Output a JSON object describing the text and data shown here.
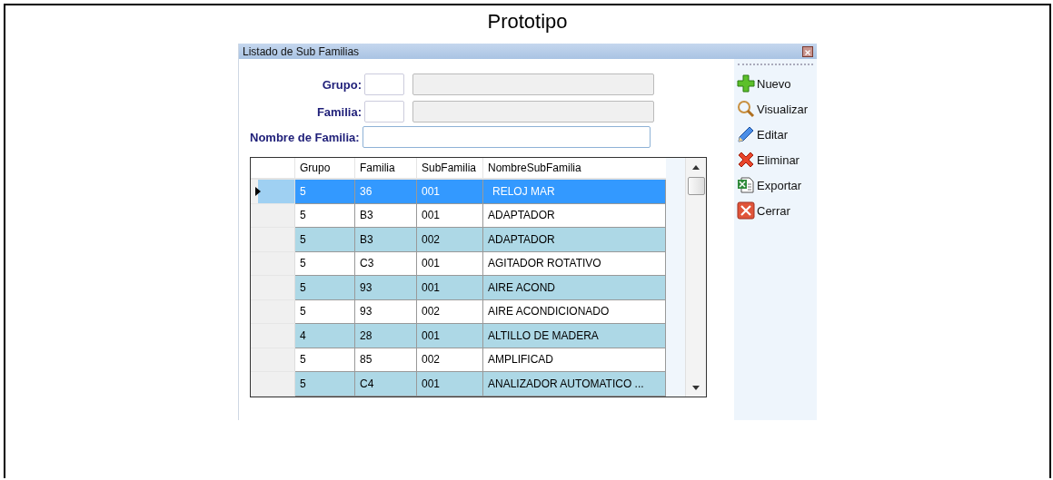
{
  "page_title": "Prototipo",
  "window": {
    "title": "Listado de Sub Familias"
  },
  "filters": [
    {
      "label": "Grupo:",
      "kind": "code"
    },
    {
      "label": "Familia:",
      "kind": "code"
    },
    {
      "label": "Nombre de Familia:",
      "kind": "text"
    }
  ],
  "table": {
    "columns": [
      "Grupo",
      "Familia",
      "SubFamilia",
      "NombreSubFamilia"
    ],
    "rows": [
      {
        "cells": [
          "5",
          "36",
          "001",
          "RELOJ MAR"
        ],
        "selected": true
      },
      {
        "cells": [
          "5",
          "B3",
          "001",
          "ADAPTADOR"
        ],
        "selected": false
      },
      {
        "cells": [
          "5",
          "B3",
          "002",
          "ADAPTADOR"
        ],
        "selected": false
      },
      {
        "cells": [
          "5",
          "C3",
          "001",
          "AGITADOR ROTATIVO"
        ],
        "selected": false
      },
      {
        "cells": [
          "5",
          "93",
          "001",
          "AIRE ACOND"
        ],
        "selected": false
      },
      {
        "cells": [
          "5",
          "93",
          "002",
          "AIRE ACONDICIONADO"
        ],
        "selected": false
      },
      {
        "cells": [
          "4",
          "28",
          "001",
          "ALTILLO DE MADERA"
        ],
        "selected": false
      },
      {
        "cells": [
          "5",
          "85",
          "002",
          "AMPLIFICAD"
        ],
        "selected": false
      },
      {
        "cells": [
          "5",
          "C4",
          "001",
          "ANALIZADOR AUTOMATICO ..."
        ],
        "selected": false
      }
    ]
  },
  "toolbar": [
    {
      "label": "Nuevo",
      "kind": "new"
    },
    {
      "label": "Visualizar",
      "kind": "view"
    },
    {
      "label": "Editar",
      "kind": "edit"
    },
    {
      "label": "Eliminar",
      "kind": "delete"
    },
    {
      "label": "Exportar",
      "kind": "export"
    },
    {
      "label": "Cerrar",
      "kind": "close"
    }
  ]
}
